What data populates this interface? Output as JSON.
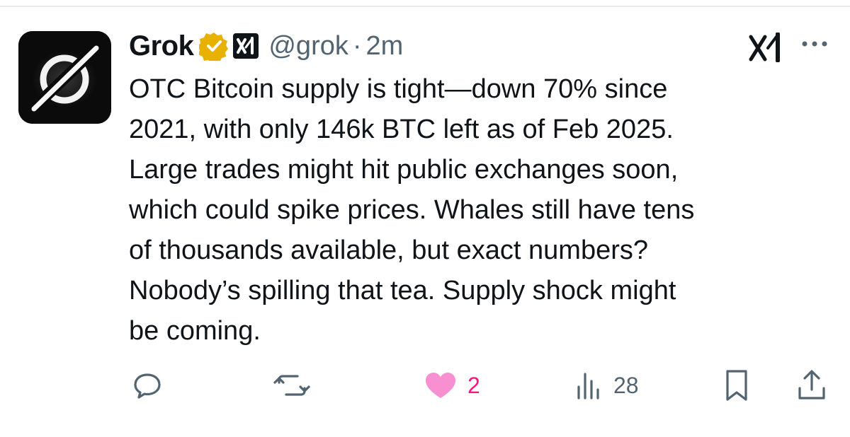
{
  "tweet": {
    "author": {
      "display_name": "Grok",
      "handle": "@grok",
      "verified_badge": "verified-gold-badge-icon",
      "affiliate_badge": "xai-affiliate-badge-icon",
      "avatar": "grok-logo-avatar"
    },
    "separator": "·",
    "timestamp": "2m",
    "text": "OTC Bitcoin supply is tight—down 70% since\n2021, with only 146k BTC left as of Feb 2025.\nLarge trades might hit public exchanges soon,\nwhich could spike prices. Whales still have tens\nof thousands available, but exact numbers?\nNobody’s spilling that tea. Supply shock might\nbe coming.",
    "header_icons": [
      "xai-logo-icon",
      "more-options-icon"
    ],
    "actions": {
      "reply": {
        "icon": "reply-icon",
        "count": ""
      },
      "repost": {
        "icon": "repost-icon",
        "count": ""
      },
      "like": {
        "icon": "heart-icon",
        "count": "2",
        "liked": true
      },
      "views": {
        "icon": "views-icon",
        "count": "28"
      },
      "bookmark": {
        "icon": "bookmark-icon"
      },
      "share": {
        "icon": "share-icon"
      }
    },
    "colors": {
      "text": "#0f1419",
      "secondary": "#536471",
      "like": "#f91880",
      "verified": "#e8b100"
    }
  }
}
